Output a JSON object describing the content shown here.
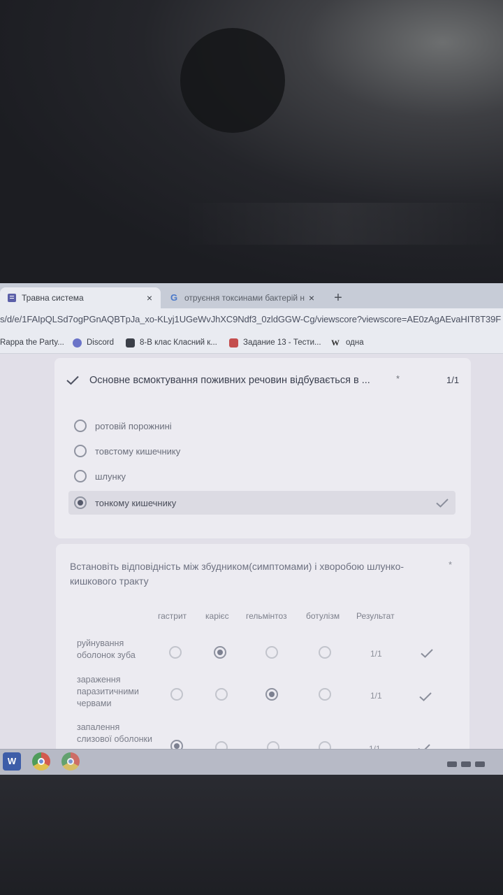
{
  "browser": {
    "tabs": [
      {
        "title": "Травна система",
        "favicon": "google-forms-icon",
        "close": "×"
      },
      {
        "title": "отруєння токсинами бактерій н",
        "favicon": "google-icon",
        "close": "×"
      }
    ],
    "new_tab": "+",
    "url": "s/d/e/1FAIpQLSd7ogPGnAQBTpJa_xo-KLyj1UGeWvJhXC9Ndf3_0zldGGW-Cg/viewscore?viewscore=AE0zAgAEvaHIT8T39F",
    "bookmarks": [
      {
        "label": "Rappa the Party...",
        "icon": "none"
      },
      {
        "label": "Discord",
        "icon": "discord-icon"
      },
      {
        "label": "8-В клас Класний к...",
        "icon": "classroom-icon"
      },
      {
        "label": "Задание 13 - Тести...",
        "icon": "bookmark-icon"
      },
      {
        "label": "одна",
        "icon": "wikipedia-icon",
        "glyph": "W"
      }
    ]
  },
  "question1": {
    "title": "Основне всмоктування поживних речовин відбувається в ...",
    "required_mark": "*",
    "score": "1/1",
    "options": [
      {
        "label": "ротовій порожнині",
        "selected": false
      },
      {
        "label": "товстому кишечнику",
        "selected": false
      },
      {
        "label": "шлунку",
        "selected": false
      },
      {
        "label": "тонкому кишечнику",
        "selected": true,
        "correct": true
      }
    ]
  },
  "question2": {
    "title": "Встановіть відповідність між збудником(симптомами) і хворобою шлунко-кишкового тракту",
    "required_mark": "*",
    "columns": [
      "гастрит",
      "карієс",
      "гельмінтоз",
      "ботулізм",
      "Результат"
    ],
    "rows": [
      {
        "label": "руйнування оболонок зуба",
        "selected_index": 1,
        "score": "1/1"
      },
      {
        "label": "зараження паразитичними червами",
        "selected_index": 2,
        "score": "1/1"
      },
      {
        "label": "запалення слизової оболонки",
        "selected_index": 0,
        "score": "1/1"
      }
    ]
  },
  "taskbar": {
    "word_glyph": "W",
    "apps": [
      "word-icon",
      "chrome-icon",
      "chrome-icon"
    ]
  },
  "colors": {
    "accent": "#5b5fa8",
    "check": "#8a8e9b"
  }
}
